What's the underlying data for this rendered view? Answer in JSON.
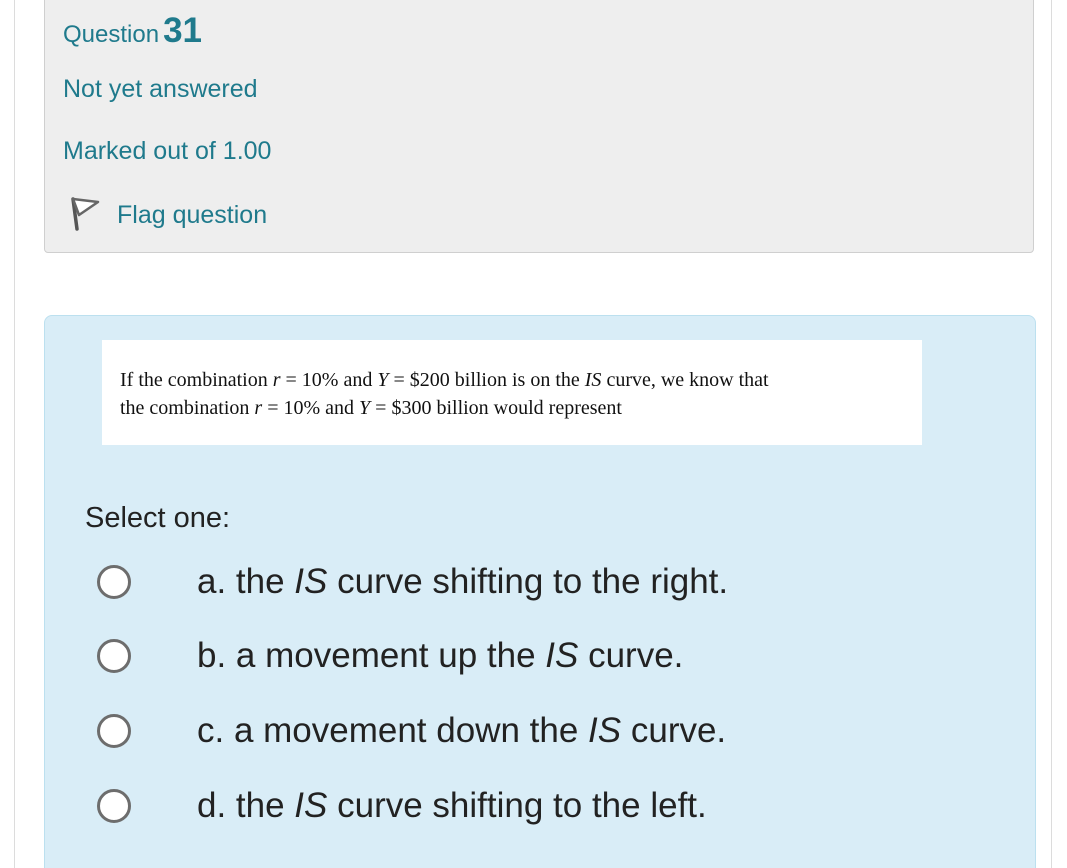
{
  "question_info": {
    "label": "Question",
    "number": "31",
    "state": "Not yet answered",
    "grade": "Marked out of 1.00",
    "flag_label": "Flag question",
    "flag_icon": "flag-outline-icon"
  },
  "question": {
    "line1": {
      "p1": "If the combination ",
      "v1": "r",
      "p2": " = 10% and ",
      "v2": "Y",
      "p3": " = $200 billion is on the ",
      "v3": "IS",
      "p4": " curve, we know that"
    },
    "line2": {
      "p1": "the combination ",
      "v1": "r",
      "p2": " = 10% and ",
      "v2": "Y",
      "p3": " = $300 billion would represent"
    }
  },
  "answer": {
    "prompt": "Select one:",
    "options": [
      {
        "pre": "a. the ",
        "em": "IS",
        "post": " curve shifting to the right."
      },
      {
        "pre": "b. a movement up the ",
        "em": "IS",
        "post": " curve."
      },
      {
        "pre": "c. a movement down the ",
        "em": "IS",
        "post": " curve."
      },
      {
        "pre": "d. the ",
        "em": "IS",
        "post": " curve shifting to the left."
      }
    ]
  },
  "colors": {
    "accent": "#1f7a8c",
    "info_bg": "#eeeeee",
    "content_bg": "#d9edf7"
  }
}
